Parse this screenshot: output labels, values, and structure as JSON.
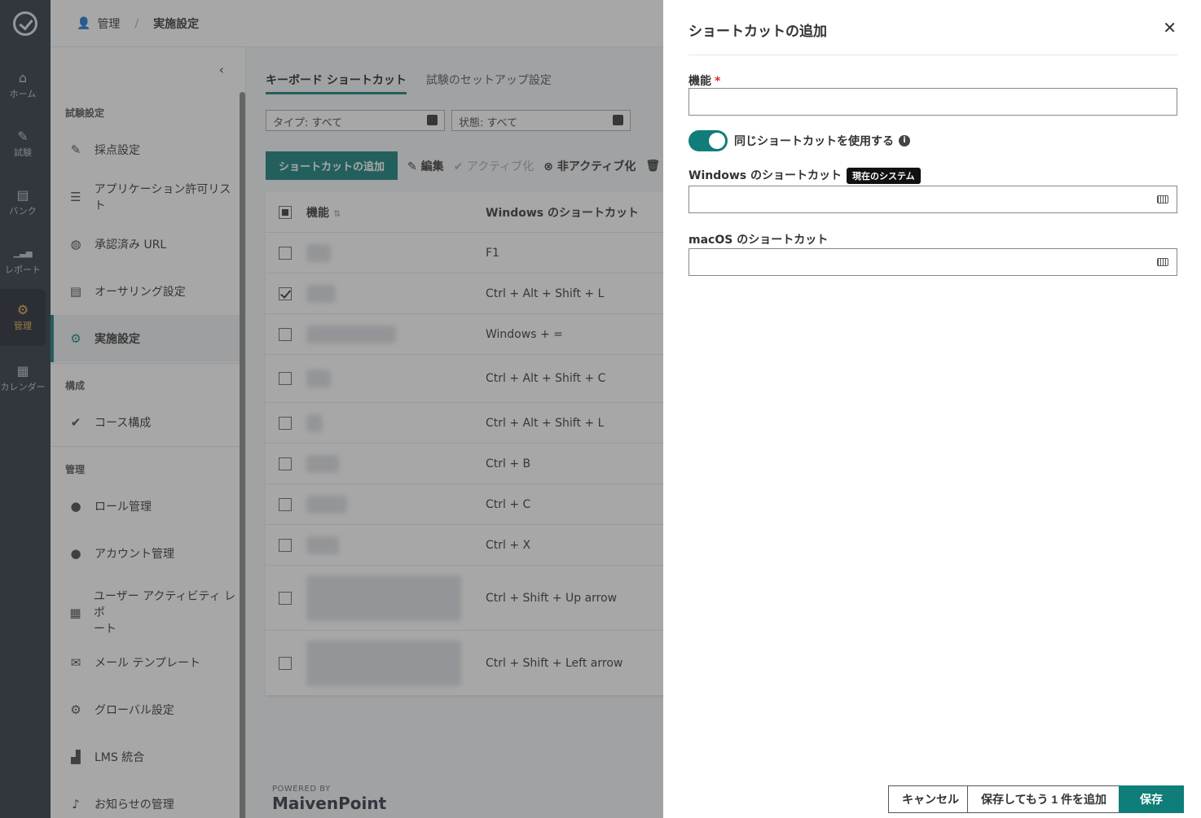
{
  "rail": {
    "items": [
      {
        "label": "ホーム",
        "icon": "home-icon",
        "glyph": "⌂"
      },
      {
        "label": "試験",
        "icon": "exam-icon",
        "glyph": "✎"
      },
      {
        "label": "バンク",
        "icon": "bank-icon",
        "glyph": "▤"
      },
      {
        "label": "レポート",
        "icon": "report-icon",
        "glyph": "▁▃▅"
      },
      {
        "label": "管理",
        "icon": "admin-icon",
        "glyph": "⚙"
      },
      {
        "label": "カレンダー",
        "icon": "calendar-icon",
        "glyph": "▦"
      }
    ]
  },
  "breadcrumb": {
    "root": "管理",
    "separator": "/",
    "current": "実施設定"
  },
  "sidebar": {
    "sections": [
      "試験設定",
      "構成",
      "管理"
    ],
    "items": [
      {
        "label": "採点設定",
        "glyph": "✎"
      },
      {
        "label": "アプリケーション許可リスト",
        "glyph": "☰"
      },
      {
        "label": "承認済み URL",
        "glyph": "◍"
      },
      {
        "label": "オーサリング設定",
        "glyph": "▤"
      },
      {
        "label": "実施設定",
        "glyph": "⚙"
      },
      {
        "label": "コース構成",
        "glyph": "✔"
      },
      {
        "label": "ロール管理",
        "glyph": "●"
      },
      {
        "label": "アカウント管理",
        "glyph": "●"
      },
      {
        "label": "ユーザー アクティビティ レポ",
        "label2": "ート",
        "glyph": "▦"
      },
      {
        "label": "メール テンプレート",
        "glyph": "✉"
      },
      {
        "label": "グローバル設定",
        "glyph": "⚙"
      },
      {
        "label": "LMS 統合",
        "glyph": "▟"
      },
      {
        "label": "お知らせの管理",
        "glyph": "♪"
      }
    ]
  },
  "main": {
    "tabs": [
      "キーボード ショートカット",
      "試験のセットアップ設定"
    ],
    "filters": [
      "タイプ: すべて",
      "状態: すべて"
    ],
    "toolbar": {
      "add": "ショートカットの追加",
      "edit": "編集",
      "activate": "アクティブ化",
      "deactivate": "非アクティブ化"
    },
    "table": {
      "col_function": "機能",
      "col_windows": "Windows のショートカット",
      "rows": [
        {
          "windows": "F1",
          "checked": false
        },
        {
          "windows": "Ctrl + Alt + Shift + L",
          "checked": true
        },
        {
          "windows": "Windows + =",
          "checked": false
        },
        {
          "windows": "Ctrl + Alt + Shift + C",
          "checked": false
        },
        {
          "windows": "Ctrl + Alt + Shift + L",
          "checked": false
        },
        {
          "windows": "Ctrl + B",
          "checked": false
        },
        {
          "windows": "Ctrl + C",
          "checked": false
        },
        {
          "windows": "Ctrl + X",
          "checked": false
        },
        {
          "windows": "Ctrl + Shift + Up arrow",
          "checked": false
        },
        {
          "windows": "Ctrl + Shift + Left arrow",
          "checked": false
        }
      ]
    },
    "powered_by": "POWERED BY",
    "brand": "MaivenPoint"
  },
  "panel": {
    "title": "ショートカットの追加",
    "function_label": "機能",
    "required_mark": "*",
    "function_value": "",
    "toggle_label": "同じショートカットを使用する",
    "toggle_on": true,
    "windows_label": "Windows のショートカット",
    "windows_badge": "現在のシステム",
    "windows_value": "",
    "mac_label": "macOS のショートカット",
    "mac_value": "",
    "buttons": {
      "cancel": "キャンセル",
      "save_add": "保存してもう 1 件を追加",
      "save": "保存"
    },
    "accent_color": "#0f7d78"
  }
}
